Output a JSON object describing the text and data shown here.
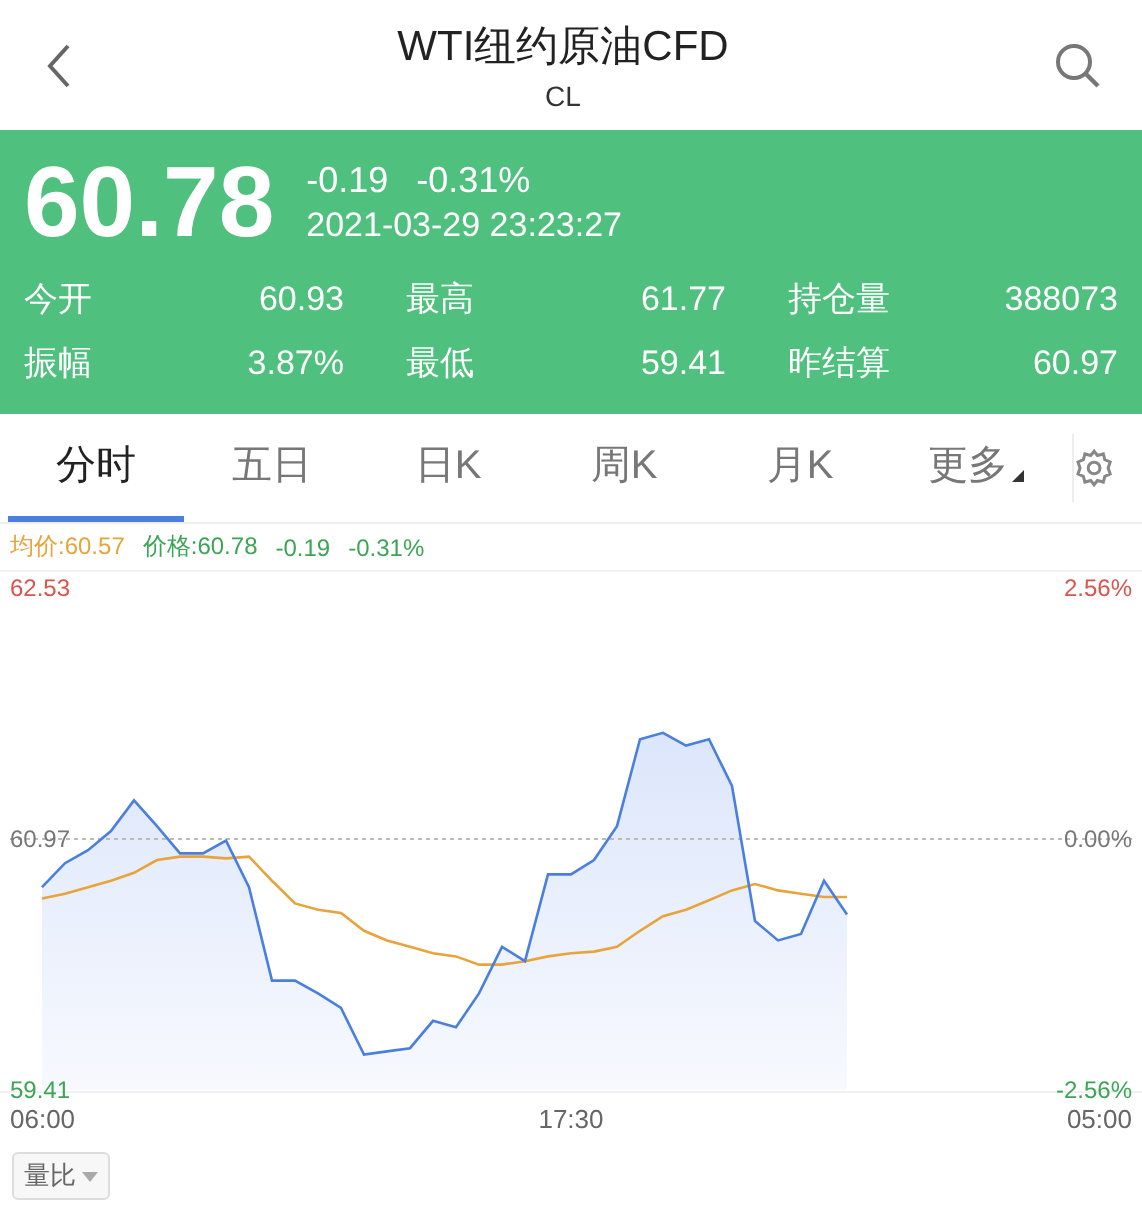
{
  "header": {
    "title": "WTI纽约原油CFD",
    "subtitle": "CL"
  },
  "quote": {
    "price": "60.78",
    "change": "-0.19",
    "change_percent": "-0.31%",
    "timestamp": "2021-03-29 23:23:27",
    "stats": [
      {
        "label": "今开",
        "value": "60.93"
      },
      {
        "label": "最高",
        "value": "61.77"
      },
      {
        "label": "持仓量",
        "value": "388073"
      },
      {
        "label": "振幅",
        "value": "3.87%"
      },
      {
        "label": "最低",
        "value": "59.41"
      },
      {
        "label": "昨结算",
        "value": "60.97"
      }
    ]
  },
  "tabs": [
    {
      "label": "分时",
      "selected": true,
      "kind": "plain"
    },
    {
      "label": "五日",
      "selected": false,
      "kind": "plain"
    },
    {
      "label": "日K",
      "selected": false,
      "kind": "plain"
    },
    {
      "label": "周K",
      "selected": false,
      "kind": "plain"
    },
    {
      "label": "月K",
      "selected": false,
      "kind": "plain"
    },
    {
      "label": "更多",
      "selected": false,
      "kind": "dropdown"
    }
  ],
  "legend": [
    {
      "kind": "series",
      "value": ":60.57",
      "color": "#e8a33a"
    },
    {
      "kind": "series",
      "value": ":60.78",
      "color": "#3aa655"
    },
    {
      "kind": "text",
      "text": "-0.19",
      "color": "#3aa655"
    },
    {
      "kind": "text",
      "text": "-0.31%",
      "color": "#3aa655"
    }
  ],
  "chart": {
    "right_labels": [
      "2.56%",
      "0.00%",
      "-2.56%"
    ],
    "chart_data": {
      "type": "line",
      "ylim": [
        59.41,
        62.53
      ],
      "yticks": [
        {
          "value": 62.53,
          "label": "62.53"
        },
        {
          "value": 60.97,
          "label": "60.97"
        },
        {
          "value": 59.41,
          "label": "59.41"
        }
      ],
      "categories": [
        "06:00",
        null,
        null,
        null,
        null,
        null,
        null,
        null,
        null,
        null,
        null,
        null,
        null,
        null,
        null,
        null,
        null,
        null,
        null,
        null,
        null,
        null,
        null,
        "17:30",
        null,
        null,
        null,
        null,
        null,
        null,
        null,
        null,
        null,
        null,
        null,
        null,
        null,
        null,
        null,
        null,
        null,
        null,
        null,
        null,
        null,
        null,
        "05:00"
      ],
      "series": [
        {
          "name": "均价",
          "color": "#e8a33a",
          "values": [
            60.6,
            60.63,
            60.67,
            60.71,
            60.76,
            60.84,
            60.86,
            60.86,
            60.85,
            60.86,
            60.71,
            60.57,
            60.53,
            60.51,
            60.4,
            60.34,
            60.3,
            60.26,
            60.24,
            60.19,
            60.19,
            60.21,
            60.24,
            60.26,
            60.27,
            60.3,
            60.4,
            60.49,
            60.53,
            60.59,
            60.65,
            60.69,
            60.65,
            60.63,
            60.61,
            60.61,
            null,
            null,
            null,
            null,
            null,
            null,
            null,
            null,
            null,
            null,
            null
          ]
        },
        {
          "name": "价格",
          "color": "#4a7fe0",
          "values": [
            60.67,
            60.82,
            60.9,
            61.02,
            61.21,
            61.05,
            60.88,
            60.88,
            60.96,
            60.67,
            60.09,
            60.09,
            60.01,
            59.92,
            59.63,
            59.65,
            59.67,
            59.84,
            59.8,
            60.01,
            60.3,
            60.21,
            60.75,
            60.75,
            60.84,
            61.05,
            61.59,
            61.63,
            61.55,
            61.59,
            61.3,
            60.46,
            60.34,
            60.38,
            60.71,
            60.5,
            null,
            null,
            null,
            null,
            null,
            null,
            null,
            null,
            null,
            null,
            null
          ]
        }
      ]
    }
  },
  "indicator": {
    "label": "量比"
  }
}
